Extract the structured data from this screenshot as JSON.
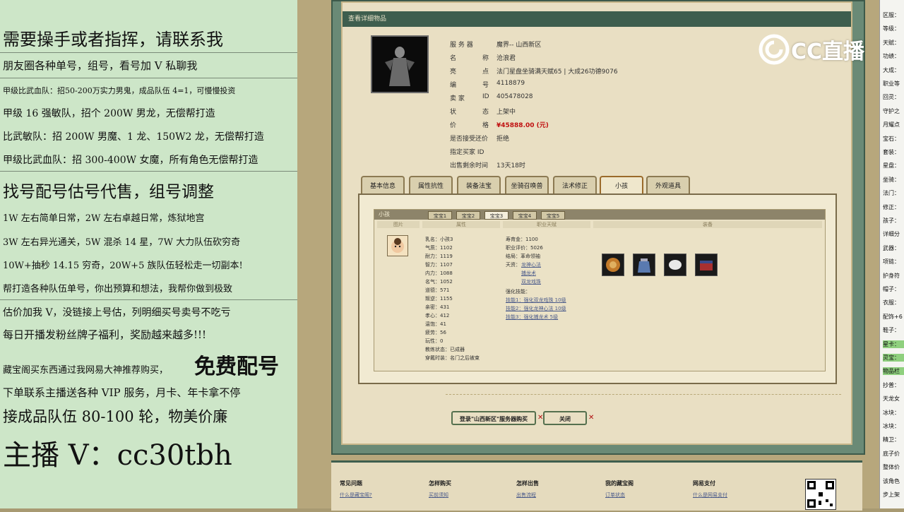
{
  "overlay": {
    "lines": [
      "需要操手或者指挥，请联系我",
      "朋友圈各种单号，组号，看号加 V 私聊我",
      "甲级比武血队：招50-200万实力男鬼，成品队伍 4=1，可慢慢投资",
      "甲级 16 强敏队，招个 200W 男龙，无偿帮打造",
      "比武敏队：招 200W 男魔、1 龙、150W2 龙，无偿帮打造",
      "甲级比武血队：招 300-400W 女魔，所有角色无偿帮打造",
      "找号配号估号代售，组号调整",
      "1W 左右简单日常，2W 左右卓越日常，炼狱地宫",
      "3W 左右异光通关，5W 混杀 14 星，7W 大力队伍砍穷奇",
      "10W+抽秒 14.15 穷奇，20W+5 族队伍轻松走一切副本!",
      "帮打造各种队伍单号，你出预算和想法，我帮你做到极致",
      "估价加我 V，没链接上号估，列明细买号卖号不吃亏",
      "每日开播发粉丝牌子福利，奖励越来越多!!!",
      "藏宝阁买东西通过我网易大神推荐购买，",
      "免费配号",
      "下单联系主播送各种 VIP 服务，月卡、年卡拿不停",
      "接成品队伍 80-100 轮，物美价廉",
      "主播 V：cc30tbh"
    ]
  },
  "game": {
    "window_title": "查看详细物品",
    "info": [
      {
        "label": "服 务 器",
        "value": "魔界-- 山西新区"
      },
      {
        "label": "名",
        "label2": "称",
        "value": "沧浪君"
      },
      {
        "label": "亮",
        "label2": "点",
        "value": "法门星盘坐骑满天赋65 | 大成26功德9076"
      },
      {
        "label": "编",
        "label2": "号",
        "value": "4118879"
      },
      {
        "label": "卖 家",
        "label2": "ID",
        "value": "405478028"
      },
      {
        "label": "状",
        "label2": "态",
        "value": "上架中"
      },
      {
        "label": "价",
        "label2": "格",
        "value": "¥45888.00 (元)"
      },
      {
        "label": "是否接受还价",
        "label2": "",
        "value": "拒绝"
      },
      {
        "label": "指定买家 ID",
        "label2": "",
        "value": ""
      },
      {
        "label": "出售剩余时间",
        "label2": "",
        "value": "13天18时"
      }
    ],
    "tabs": [
      "基本信息",
      "属性抗性",
      "装备法宝",
      "坐骑召唤兽",
      "法术修正",
      "小孩",
      "外观道具"
    ],
    "active_tab": "小孩",
    "panel_title": "小孩",
    "sub_tabs": [
      "宝宝1",
      "宝宝2",
      "宝宝3",
      "宝宝4",
      "宝宝5"
    ],
    "active_sub_tab": "宝宝3",
    "col_headers": [
      "图片",
      "属性",
      "职业天赋",
      "装备"
    ],
    "child_stats": [
      "乳名：小孩3",
      "气质：1102",
      "耐力：1119",
      "智力：1107",
      "内力：1088",
      "名气：1052",
      "道德：571",
      "叛逆：1155",
      "亲密：431",
      "孝心：412",
      "温饱：41",
      "疲劳：56",
      "玩性：0",
      "教练状态：已成器",
      "穿戴时装：名门之后被束"
    ],
    "career": {
      "lines": [
        "寿育金：1100",
        "职业评价：5026",
        "结局：革命领袖"
      ],
      "talent_label": "天资：",
      "talents": [
        "龙神心法",
        "捕龙术",
        "双龙戏珠"
      ],
      "skill_label": "强化技能：",
      "skills": [
        "技能1：强化双龙戏珠 10级",
        "技能2：强化龙神心法 10级",
        "技能3：强化捕龙术 5级"
      ]
    },
    "equipment": [
      "盾牌装备",
      "香水瓶装备",
      "宝珠装备",
      "锦盒装备"
    ],
    "buttons": {
      "login": "登录\"山西新区\"服务器购买",
      "close": "关闭"
    },
    "footer": [
      {
        "title": "常见问题",
        "links": [
          "什么是藏宝阁?",
          "常见问题"
        ]
      },
      {
        "title": "怎样购买",
        "links": [
          "买前须知",
          "购买流程"
        ]
      },
      {
        "title": "怎样出售",
        "links": [
          "出售流程",
          "公示期"
        ]
      },
      {
        "title": "我的藏宝阁",
        "links": [
          "订单状态",
          "物品状态"
        ]
      },
      {
        "title": "网易支付",
        "links": [
          "什么是网易支付",
          "收费规则"
        ]
      }
    ]
  },
  "logo": {
    "text": "CC直播"
  },
  "right_panel": {
    "items": [
      "区服：",
      "等级：",
      "天赋：",
      "功绩：",
      "大成：",
      "职业等",
      "回灵：",
      "守护之",
      "月耀点",
      "宝石：",
      "套装：",
      "星盘：",
      "坐骑：",
      "法门：",
      "修正：",
      "孩子：",
      "详细分",
      "武器：",
      "项链：",
      "护身符",
      "帽子：",
      "衣服：",
      "配饰+6",
      "鞋子：",
      "星卡：",
      "灵宝：",
      "物品栏",
      "抄普：",
      "天龙女",
      "冰块：",
      "冰块：",
      "精卫：",
      "底子价",
      "整体价",
      "该角色",
      "步上架"
    ],
    "highlighted": [
      "星卡：",
      "灵宝：",
      "物品栏"
    ]
  }
}
